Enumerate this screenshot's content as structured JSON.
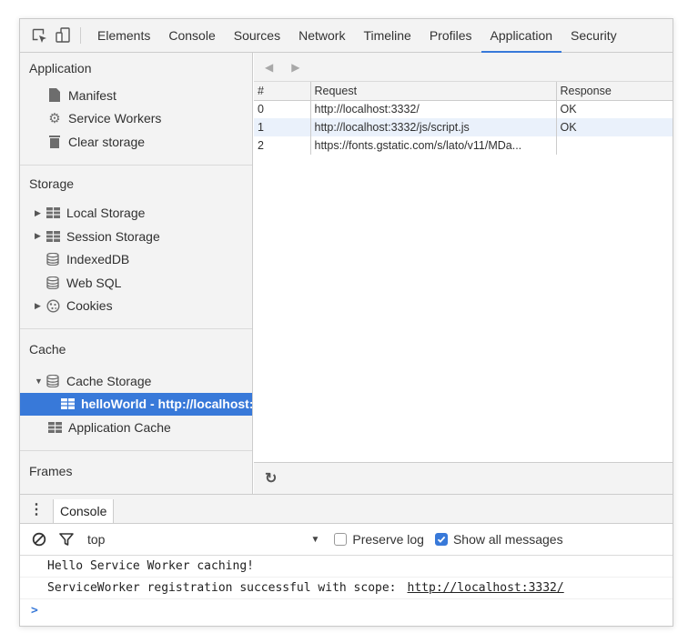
{
  "tabs": [
    "Elements",
    "Console",
    "Sources",
    "Network",
    "Timeline",
    "Profiles",
    "Application",
    "Security"
  ],
  "active_tab": "Application",
  "toolbar_icons": [
    "inspect-element-icon",
    "device-toolbar-icon"
  ],
  "sidebar": {
    "application": {
      "title": "Application",
      "items": [
        {
          "label": "Manifest",
          "icon": "document-icon"
        },
        {
          "label": "Service Workers",
          "icon": "gear-icon"
        },
        {
          "label": "Clear storage",
          "icon": "trash-icon"
        }
      ]
    },
    "storage": {
      "title": "Storage",
      "items": [
        {
          "label": "Local Storage",
          "icon": "grid-icon",
          "expandable": true
        },
        {
          "label": "Session Storage",
          "icon": "grid-icon",
          "expandable": true
        },
        {
          "label": "IndexedDB",
          "icon": "database-icon"
        },
        {
          "label": "Web SQL",
          "icon": "database-icon"
        },
        {
          "label": "Cookies",
          "icon": "cookie-icon",
          "expandable": true
        }
      ]
    },
    "cache": {
      "title": "Cache",
      "items": [
        {
          "label": "Cache Storage",
          "icon": "database-icon",
          "expanded": true
        },
        {
          "label": "helloWorld - http://localhost:",
          "icon": "grid-icon",
          "selected": true
        },
        {
          "label": "Application Cache",
          "icon": "grid-icon"
        }
      ]
    },
    "frames": {
      "title": "Frames"
    }
  },
  "table": {
    "headers": [
      "#",
      "Request",
      "Response"
    ],
    "rows": [
      {
        "num": "0",
        "request": "http://localhost:3332/",
        "response": "OK"
      },
      {
        "num": "1",
        "request": "http://localhost:3332/js/script.js",
        "response": "OK"
      },
      {
        "num": "2",
        "request": "https://fonts.gstatic.com/s/lato/v11/MDa...",
        "response": ""
      }
    ]
  },
  "console": {
    "tab_label": "Console",
    "context": "top",
    "preserve_log": {
      "label": "Preserve log",
      "checked": false
    },
    "show_all": {
      "label": "Show all messages",
      "checked": true
    },
    "messages": [
      {
        "text": "Hello Service Worker caching!",
        "link": ""
      },
      {
        "text": "ServiceWorker registration successful with scope:",
        "link": "http://localhost:3332/"
      }
    ],
    "prompt": ">"
  },
  "colors": {
    "accent": "#3879d9",
    "panel": "#f3f3f3",
    "border": "#cccccc"
  }
}
